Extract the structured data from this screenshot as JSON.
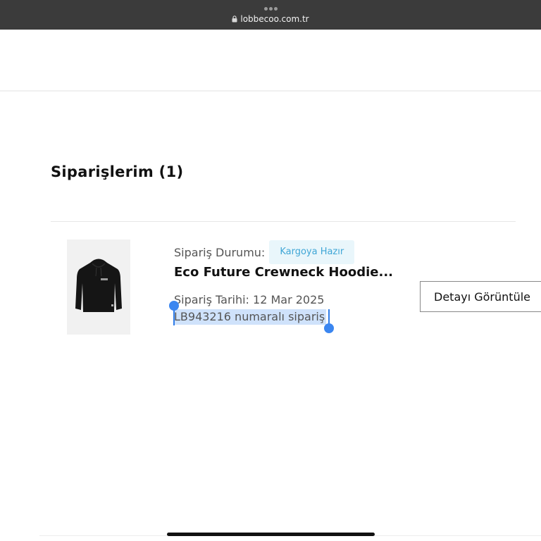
{
  "browser": {
    "url": "lobbecoo.com.tr"
  },
  "page": {
    "title": "Siparişlerim (1)"
  },
  "order": {
    "status_label": "Sipariş Durumu:",
    "status_value": "Kargoya Hazır",
    "product_title": "Eco Future Crewneck Hoodie...",
    "date_text": "Sipariş Tarihi: 12 Mar 2025",
    "number_text": "LB943216 numaralı sipariş",
    "detail_button_label": "Detayı Görüntüle",
    "image_icon": "black-hoodie-product-image"
  },
  "colors": {
    "badge_text": "#3fa6d6",
    "badge_background": "#e9f6fb",
    "selection_highlight": "#cfe2fb",
    "selection_handle": "#3b86f0"
  }
}
